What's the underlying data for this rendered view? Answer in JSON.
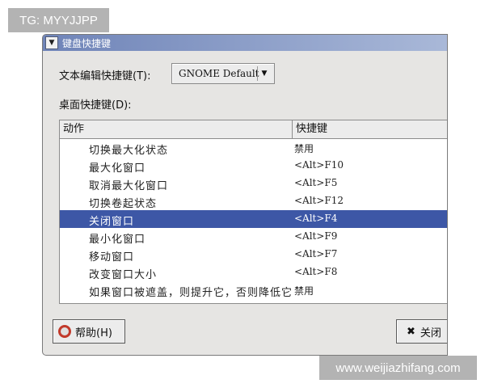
{
  "watermarks": {
    "top": "TG: MYYJJPP",
    "bottom": "www.weijiazhifang.com"
  },
  "window": {
    "title": "键盘快捷键"
  },
  "form": {
    "editing_label": "文本编辑快捷键(T):",
    "editing_value": "GNOME Default",
    "desktop_label": "桌面快捷键(D):"
  },
  "table": {
    "headers": {
      "action": "动作",
      "shortcut": "快捷键"
    },
    "rows": [
      {
        "action": "切换最大化状态",
        "shortcut": "禁用"
      },
      {
        "action": "最大化窗口",
        "shortcut": "<Alt>F10"
      },
      {
        "action": "取消最大化窗口",
        "shortcut": "<Alt>F5"
      },
      {
        "action": "切换卷起状态",
        "shortcut": "<Alt>F12"
      },
      {
        "action": "关闭窗口",
        "shortcut": "<Alt>F4"
      },
      {
        "action": "最小化窗口",
        "shortcut": "<Alt>F9"
      },
      {
        "action": "移动窗口",
        "shortcut": "<Alt>F7"
      },
      {
        "action": "改变窗口大小",
        "shortcut": "<Alt>F8"
      },
      {
        "action": "如果窗口被遮盖，则提升它，否则降低它",
        "shortcut": "禁用"
      }
    ],
    "selected_row": 4
  },
  "buttons": {
    "help": "帮助(H)",
    "close": "关闭"
  },
  "icons": {
    "window_menu": "chevron-down-icon",
    "combo": "dropdown-arrow-icon",
    "help": "lifebuoy-icon",
    "close": "close-x-icon"
  },
  "colors": {
    "selection": "#3d57a6",
    "titlebar": "#6f84b8",
    "dialog_bg": "#e6e5e3"
  }
}
